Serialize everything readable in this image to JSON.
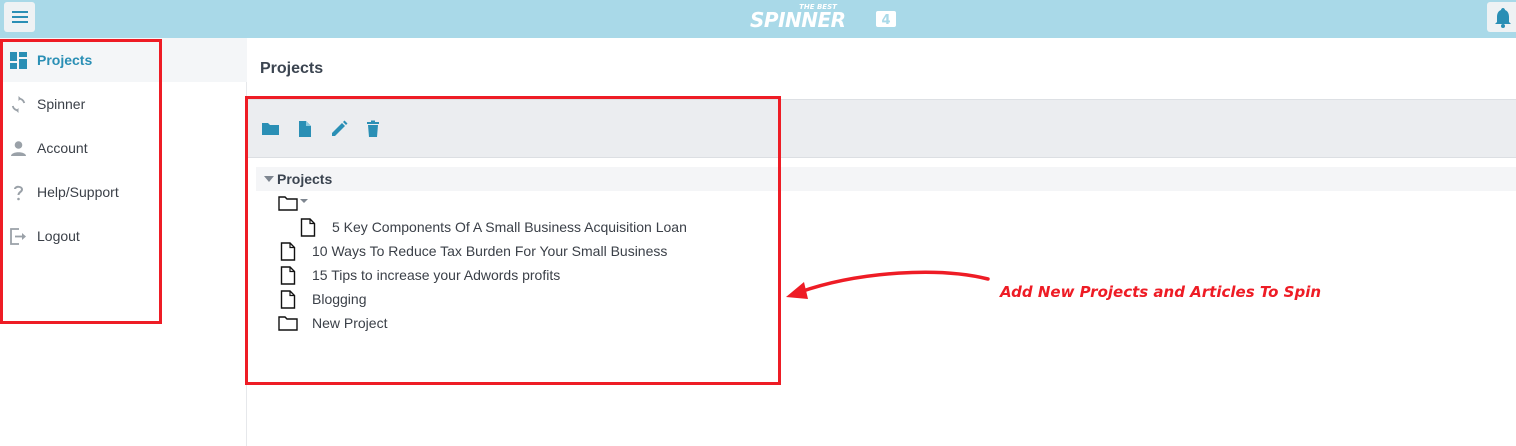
{
  "header": {
    "logo_small": "THE BEST",
    "logo_main": "SPINNER",
    "logo_badge": "4"
  },
  "sidebar": {
    "items": [
      {
        "label": "Projects",
        "icon": "dashboard-icon",
        "active": true
      },
      {
        "label": "Spinner",
        "icon": "refresh-icon",
        "active": false
      },
      {
        "label": "Account",
        "icon": "user-icon",
        "active": false
      },
      {
        "label": "Help/Support",
        "icon": "question-icon",
        "active": false
      },
      {
        "label": "Logout",
        "icon": "logout-icon",
        "active": false
      }
    ]
  },
  "main": {
    "title": "Projects",
    "toolbar": [
      "new-folder-icon",
      "new-file-icon",
      "edit-icon",
      "delete-icon"
    ],
    "tree": {
      "root_label": "Projects",
      "nodes": [
        {
          "type": "folder",
          "label": "",
          "expanded": true
        },
        {
          "type": "file",
          "label": "5 Key Components Of A Small Business Acquisition Loan"
        },
        {
          "type": "file",
          "label": "10 Ways To Reduce Tax Burden For Your Small Business"
        },
        {
          "type": "file",
          "label": "15 Tips to increase your Adwords profits"
        },
        {
          "type": "file",
          "label": "Blogging"
        },
        {
          "type": "folder",
          "label": "New Project"
        }
      ]
    }
  },
  "annotation": {
    "text": "Add New Projects and Articles To Spin",
    "color": "#ee1c25"
  },
  "colors": {
    "topbar": "#a9d9e8",
    "accent": "#2a8fb5"
  }
}
